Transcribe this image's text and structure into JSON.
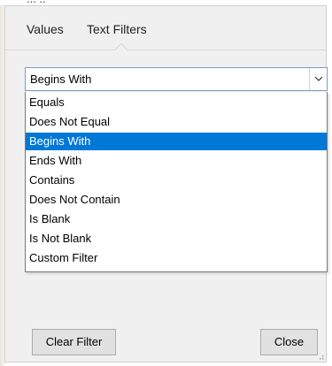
{
  "background": {
    "fragments": [
      "... ..",
      "-- ------"
    ]
  },
  "tabs": [
    {
      "label": "Values",
      "active": false
    },
    {
      "label": "Text Filters",
      "active": true
    }
  ],
  "filter": {
    "selected_value": "Begins With",
    "options": [
      "Equals",
      "Does Not Equal",
      "Begins With",
      "Ends With",
      "Contains",
      "Does Not Contain",
      "Is Blank",
      "Is Not Blank",
      "Custom Filter"
    ],
    "dropdown_icon": "chevron-down-icon"
  },
  "buttons": {
    "clear_label": "Clear Filter",
    "close_label": "Close"
  },
  "colors": {
    "selection": "#0078d7",
    "dialog_bg": "#f0f0f0",
    "button_bg": "#e1e1e1"
  }
}
